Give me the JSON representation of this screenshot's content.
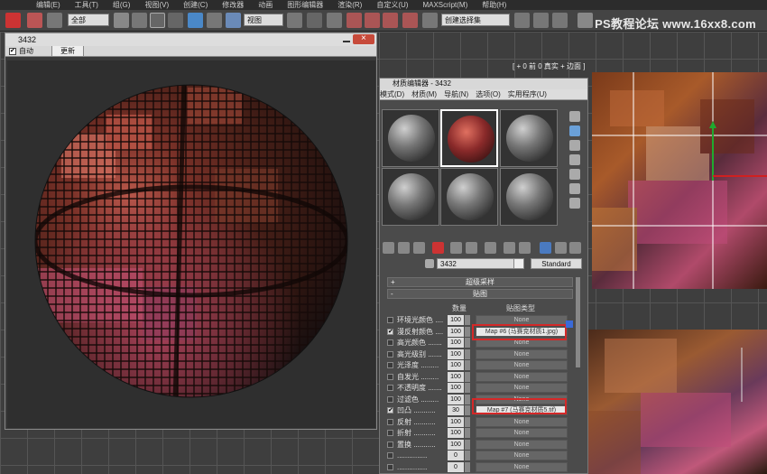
{
  "menubar": {
    "items": [
      "编辑(E)",
      "工具(T)",
      "组(G)",
      "视图(V)",
      "创建(C)",
      "修改器",
      "动画",
      "图形编辑器",
      "渲染(R)",
      "自定义(U)",
      "MAXScript(M)",
      "帮助(H)"
    ]
  },
  "toolbar": {
    "selection_filter": "全部",
    "view_dropdown": "视图",
    "selection_set": "创建选择集",
    "watermark": "PS教程论坛 www.16xx8.com"
  },
  "viewport": {
    "label": "[ + 0 前 0 真实 + 边面 ]"
  },
  "render_window": {
    "title": "3432",
    "auto_label": "自动",
    "update_label": "更新"
  },
  "material_editor": {
    "title": "材质编辑器 - 3432",
    "menu": [
      "模式(D)",
      "材质(M)",
      "导航(N)",
      "选项(O)",
      "实用程序(U)"
    ],
    "material_name": "3432",
    "material_type": "Standard",
    "rollouts": {
      "supersampling": "超级采样",
      "maps": "贴图"
    },
    "columns": {
      "amount": "数量",
      "map_type": "贴图类型"
    },
    "maps": [
      {
        "label": "环境光颜色 ....",
        "checked": false,
        "amount": "100",
        "map": "None"
      },
      {
        "label": "漫反射颜色 ....",
        "checked": true,
        "amount": "100",
        "map": "Map #6 (马赛克材质1.jpg)"
      },
      {
        "label": "高光颜色 .......",
        "checked": false,
        "amount": "100",
        "map": "None"
      },
      {
        "label": "高光级别 .......",
        "checked": false,
        "amount": "100",
        "map": "None"
      },
      {
        "label": "光泽度 .........",
        "checked": false,
        "amount": "100",
        "map": "None"
      },
      {
        "label": "自发光 .........",
        "checked": false,
        "amount": "100",
        "map": "None"
      },
      {
        "label": "不透明度 .......",
        "checked": false,
        "amount": "100",
        "map": "None"
      },
      {
        "label": "过滤色 .........",
        "checked": false,
        "amount": "100",
        "map": "None"
      },
      {
        "label": "凹凸 ...........",
        "checked": true,
        "amount": "30",
        "map": "Map #7 (马赛克材质5.tif)"
      },
      {
        "label": "反射 ...........",
        "checked": false,
        "amount": "100",
        "map": "None"
      },
      {
        "label": "折射 ...........",
        "checked": false,
        "amount": "100",
        "map": "None"
      },
      {
        "label": "置换 ...........",
        "checked": false,
        "amount": "100",
        "map": "None"
      },
      {
        "label": "...............",
        "checked": false,
        "amount": "0",
        "map": "None"
      },
      {
        "label": "...............",
        "checked": false,
        "amount": "0",
        "map": "None"
      }
    ]
  },
  "colors": {
    "highlight": "#d42828",
    "window_bg": "#3a3a3a",
    "titlebar": "#d8d8d8"
  }
}
